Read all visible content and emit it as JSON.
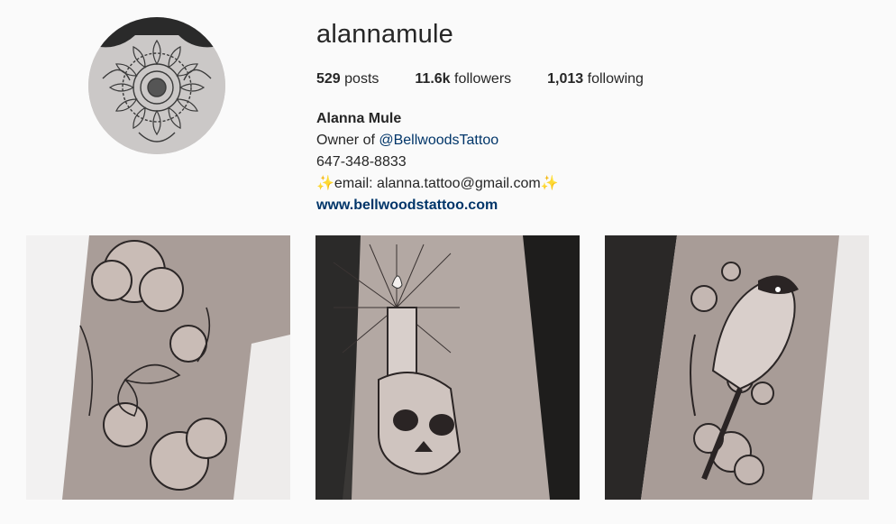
{
  "profile": {
    "username": "alannamule",
    "avatar_icon": "mandala-tattoo-avatar",
    "stats": {
      "posts_count": "529",
      "posts_label": "posts",
      "followers_count": "11.6k",
      "followers_label": "followers",
      "following_count": "1,013",
      "following_label": "following"
    },
    "bio": {
      "full_name": "Alanna Mule",
      "owner_prefix": "Owner of ",
      "owner_handle": "@BellwoodsTattoo",
      "phone": "647-348-8833",
      "email_sparkle_left": "✨",
      "email_text": "email: alanna.tattoo@gmail.com",
      "email_sparkle_right": "✨",
      "website": "www.bellwoodstattoo.com"
    }
  },
  "posts": [
    {
      "subject": "floral-butterfly-arm-tattoo"
    },
    {
      "subject": "candle-skull-arm-tattoo"
    },
    {
      "subject": "chickadee-bird-arm-tattoo"
    }
  ],
  "colors": {
    "background": "#fafafa",
    "text": "#262626",
    "link": "#003569"
  }
}
